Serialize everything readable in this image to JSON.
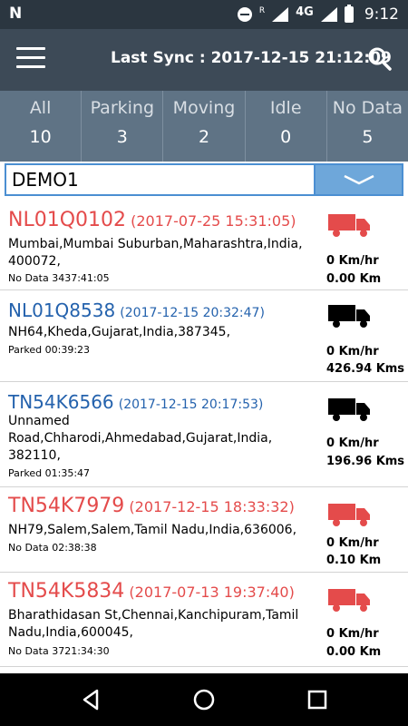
{
  "status_bar": {
    "time": "9:12",
    "network": "4G",
    "roaming": "R"
  },
  "toolbar": {
    "sync_text": "Last Sync : 2017-12-15 21:12:09"
  },
  "tabs": [
    {
      "label": "All",
      "count": "10"
    },
    {
      "label": "Parking",
      "count": "3"
    },
    {
      "label": "Moving",
      "count": "2"
    },
    {
      "label": "Idle",
      "count": "0"
    },
    {
      "label": "No Data",
      "count": "5"
    }
  ],
  "filter": {
    "value": "DEMO1"
  },
  "vehicles": [
    {
      "plate": "NL01Q0102",
      "timestamp": "(2017-07-25 15:31:05)",
      "address": "Mumbai,Mumbai Suburban,Maharashtra,India, 400072,",
      "status": "No Data 3437:41:05",
      "speed": "0 Km/hr",
      "distance": "0.00 Km",
      "state": "no-data"
    },
    {
      "plate": "NL01Q8538",
      "timestamp": "(2017-12-15 20:32:47)",
      "address": "NH64,Kheda,Gujarat,India,387345,",
      "status": "Parked 00:39:23",
      "speed": "0 Km/hr",
      "distance": "426.94 Kms",
      "state": "parked"
    },
    {
      "plate": "TN54K6566",
      "timestamp": "(2017-12-15 20:17:53)",
      "address": "Unnamed Road,Chharodi,Ahmedabad,Gujarat,India, 382110,",
      "status": "Parked 01:35:47",
      "speed": "0 Km/hr",
      "distance": "196.96 Kms",
      "state": "parked"
    },
    {
      "plate": "TN54K7979",
      "timestamp": "(2017-12-15 18:33:32)",
      "address": "NH79,Salem,Salem,Tamil Nadu,India,636006,",
      "status": "No Data 02:38:38",
      "speed": "0 Km/hr",
      "distance": "0.10 Km",
      "state": "no-data"
    },
    {
      "plate": "TN54K5834",
      "timestamp": "(2017-07-13 19:37:40)",
      "address": "Bharathidasan St,Chennai,Kanchipuram,Tamil Nadu,India,600045,",
      "status": "No Data 3721:34:30",
      "speed": "0 Km/hr",
      "distance": "0.00 Km",
      "state": "no-data"
    }
  ],
  "colors": {
    "no_data": "#e44b4b",
    "parked": "#2462ad",
    "toolbar": "#3d4a57",
    "tabs": "#5f7385"
  },
  "icons": {
    "menu": "hamburger-icon",
    "search": "search-icon",
    "dropdown": "chevron-down-icon",
    "truck": "truck-icon"
  }
}
